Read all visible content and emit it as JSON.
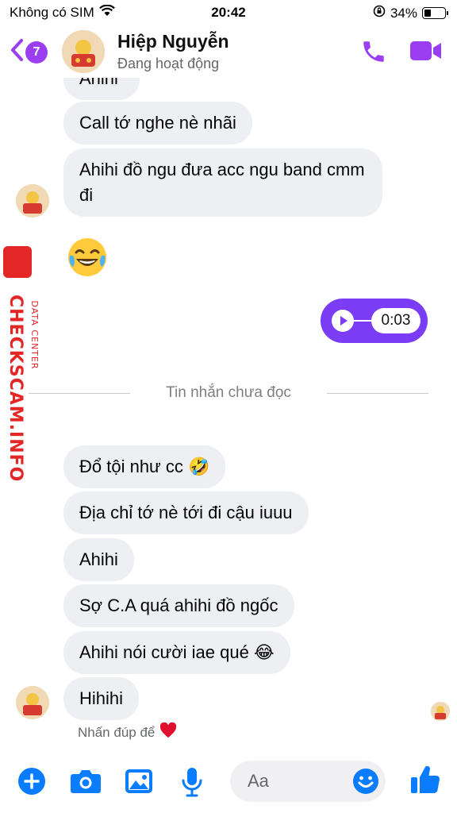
{
  "status_bar": {
    "carrier": "Không có SIM",
    "time": "20:42",
    "battery": "34%",
    "battery_level": 0.34
  },
  "header": {
    "back_count": "7",
    "name": "Hiệp Nguyễn",
    "status": "Đang hoạt động"
  },
  "messages_before": [
    {
      "text": "Ahihi"
    },
    {
      "text": "Call tớ nghe nè nhãi"
    },
    {
      "text": "Ahihi đồ ngu đưa acc ngu band cmm đi"
    }
  ],
  "emoji_message": "😂",
  "voice_message": {
    "duration": "0:03"
  },
  "unread_divider": "Tin nhắn chưa đọc",
  "messages_after": [
    {
      "text": "Đổ tội như cc 🤣"
    },
    {
      "text": "Địa chỉ tớ nè tới đi cậu iuuu"
    },
    {
      "text": "Ahihi"
    },
    {
      "text": "Sợ C.A quá ahihi đồ ngốc"
    },
    {
      "text": "Ahihi nói cười iae qué 😂"
    },
    {
      "text": "Hihihi"
    }
  ],
  "reaction_hint": "Nhấn đúp để",
  "reaction_emoji": "❤️",
  "composer": {
    "placeholder": "Aa"
  },
  "watermark": {
    "brand": "CHECKSCAM.INFO",
    "sub": "DATA CENTER"
  },
  "colors": {
    "accent": "#9b3df0",
    "voice": "#7a3cf4",
    "bubble": "#eeeff2",
    "watermark": "#e32626",
    "composer_icon": "#0a7cff"
  },
  "icons": [
    "chevron-left-icon",
    "phone-icon",
    "video-camera-icon",
    "play-icon",
    "plus-icon",
    "camera-icon",
    "image-icon",
    "microphone-icon",
    "emoji-icon",
    "thumbs-up-icon",
    "heart-icon"
  ]
}
